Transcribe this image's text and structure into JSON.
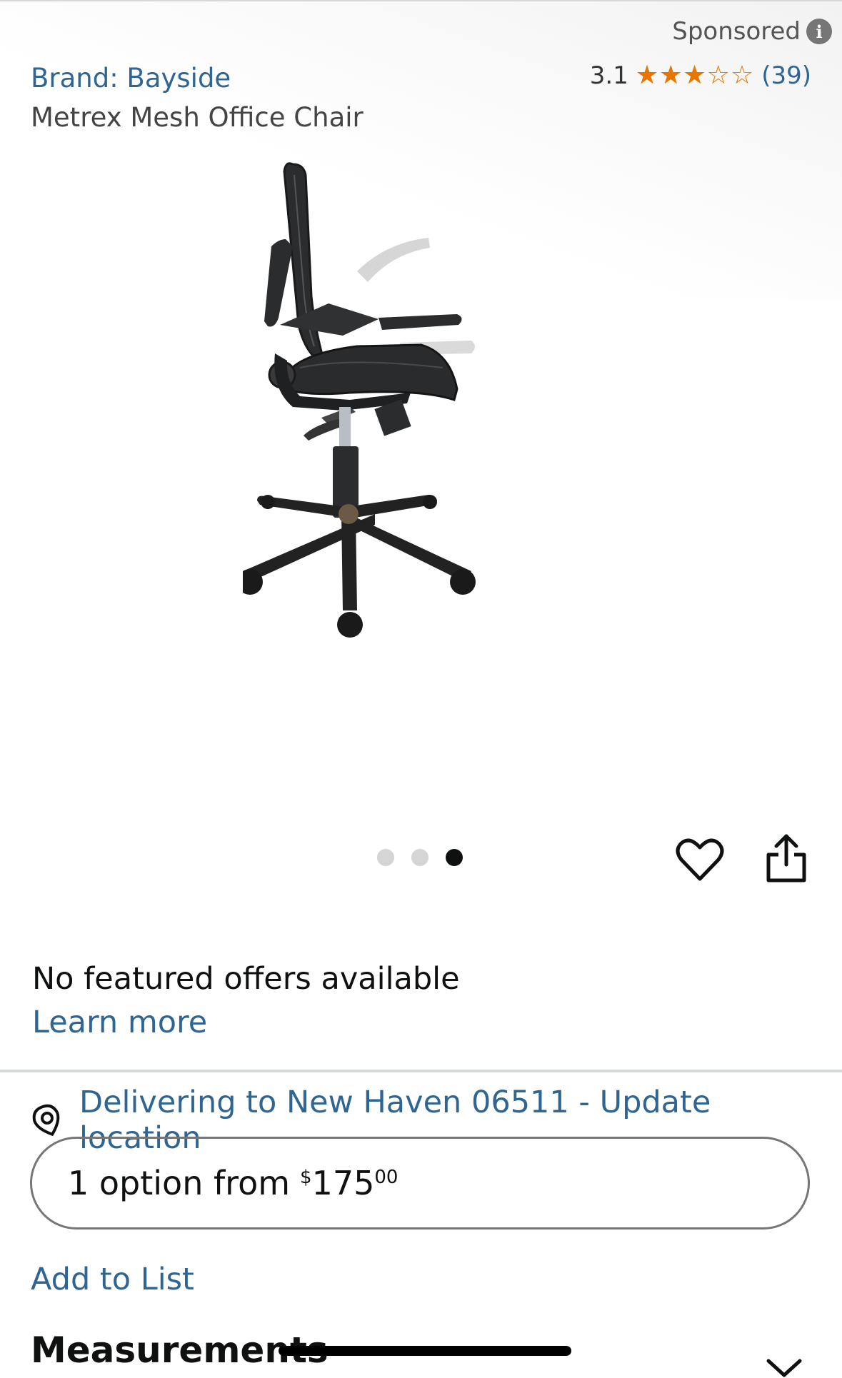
{
  "sponsored": {
    "label": "Sponsored",
    "icon": "info-icon"
  },
  "product": {
    "brand": "Brand: Bayside",
    "title": "Metrex Mesh Office Chair",
    "rating": {
      "value": "3.1",
      "stars_filled_fraction": 0.62,
      "stars": "★★★★★",
      "count": "(39)"
    },
    "image_alt": "office-chair-image",
    "carousel": {
      "total": 3,
      "active": 3
    }
  },
  "actions": {
    "wishlist_icon": "heart-icon",
    "share_icon": "share-icon"
  },
  "offers": {
    "message": "No featured offers available",
    "learn_more": "Learn more"
  },
  "delivery": {
    "icon": "location-pin-icon",
    "text": "Delivering to New Haven 06511 - Update location"
  },
  "options": {
    "label": "1 option from",
    "currency": "$",
    "price_whole": "175",
    "price_fraction": "00"
  },
  "add_to_list": "Add to List",
  "measurements": {
    "heading": "Measurements",
    "icon": "chevron-down-icon"
  },
  "colors": {
    "link": "#2f6593",
    "star": "#e77600",
    "text": "#0f1111"
  }
}
